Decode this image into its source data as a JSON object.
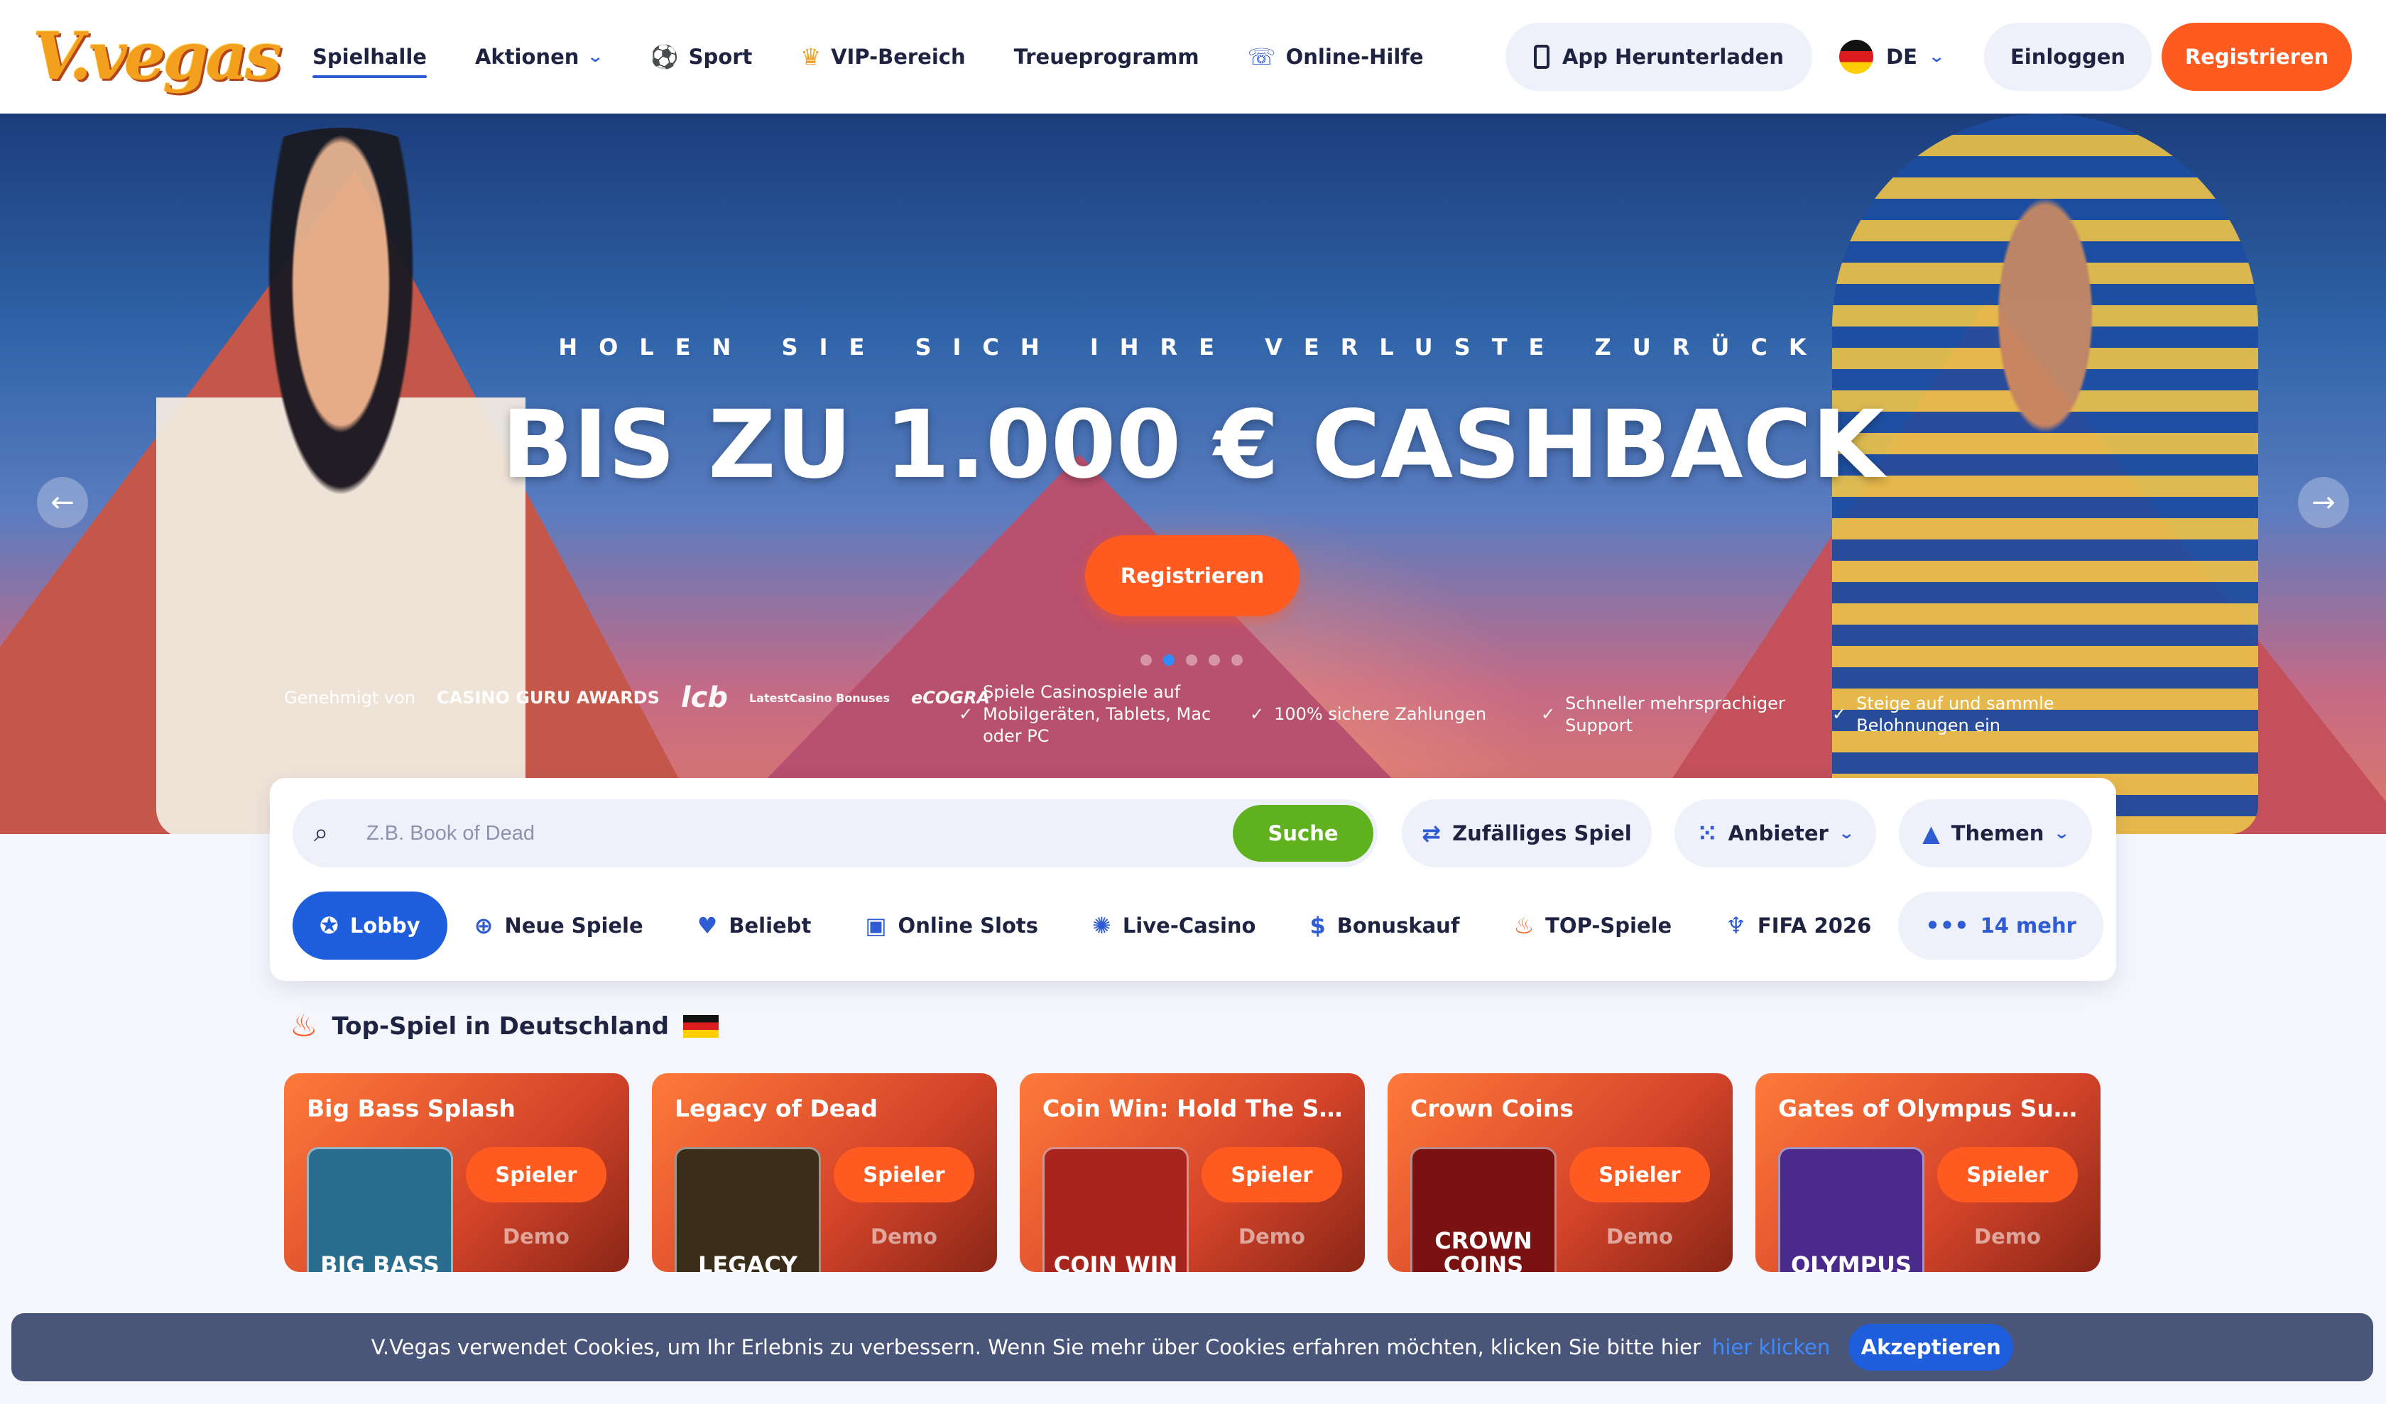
{
  "header": {
    "logo": "V.vegas",
    "nav": [
      {
        "label": "Spielhalle",
        "icon": "",
        "active": true
      },
      {
        "label": "Aktionen",
        "icon": "",
        "dropdown": true
      },
      {
        "label": "Sport",
        "icon": "soccer-ball-icon"
      },
      {
        "label": "VIP-Bereich",
        "icon": "crown-icon"
      },
      {
        "label": "Treueprogramm",
        "icon": ""
      },
      {
        "label": "Online-Hilfe",
        "icon": "headset-icon"
      }
    ],
    "app_button": "App Herunterladen",
    "language": "DE",
    "login": "Einloggen",
    "register": "Registrieren"
  },
  "hero": {
    "subtitle": "HOLEN SIE SICH IHRE VERLUSTE ZURÜCK",
    "title": "BIS ZU 1.000 € CASHBACK",
    "cta": "Registrieren",
    "slides": 5,
    "active_slide": 2,
    "trust_label": "Genehmigt von",
    "trust_logos": [
      "CASINO GURU AWARDS",
      "lcb",
      "LatestCasino Bonuses",
      "eCOGRA"
    ],
    "features": [
      "Spiele Casinospiele auf Mobilgeräten, Tablets, Mac oder PC",
      "100% sichere Zahlungen",
      "Schneller mehrsprachiger Support",
      "Steige auf und sammle Belohnungen ein"
    ]
  },
  "search": {
    "placeholder": "Z.B. Book of Dead",
    "button": "Suche",
    "random": "Zufälliges Spiel",
    "providers": "Anbieter",
    "themes": "Themen"
  },
  "categories": [
    {
      "label": "Lobby",
      "icon": "medal-icon",
      "active": true
    },
    {
      "label": "Neue Spiele",
      "icon": "plus-circle-icon"
    },
    {
      "label": "Beliebt",
      "icon": "heart-icon"
    },
    {
      "label": "Online Slots",
      "icon": "slot-machine-icon"
    },
    {
      "label": "Live-Casino",
      "icon": "chip-icon"
    },
    {
      "label": "Bonuskauf",
      "icon": "dollar-icon"
    },
    {
      "label": "TOP-Spiele",
      "icon": "flame-icon"
    },
    {
      "label": "FIFA 2026",
      "icon": "trophy-icon"
    },
    {
      "label": "14 mehr",
      "icon": "more-icon",
      "more": true
    }
  ],
  "top_games": {
    "title": "Top-Spiel in Deutschland",
    "play_label": "Spieler",
    "demo_label": "Demo",
    "games": [
      {
        "title": "Big Bass Splash",
        "thumb": "BIG BASS",
        "color": "#2a6e8f"
      },
      {
        "title": "Legacy of Dead",
        "thumb": "LEGACY",
        "color": "#3a2d1a"
      },
      {
        "title": "Coin Win: Hold The Spin",
        "thumb": "COIN WIN",
        "color": "#a8251d"
      },
      {
        "title": "Crown Coins",
        "thumb": "CROWN COINS",
        "color": "#7a1212"
      },
      {
        "title": "Gates of Olympus Super ...",
        "thumb": "OLYMPUS",
        "color": "#4a2a8a"
      }
    ]
  },
  "cookie": {
    "text": "V.Vegas verwendet Cookies, um Ihr Erlebnis zu verbessern. Wenn Sie mehr über Cookies erfahren möchten, klicken Sie bitte hier",
    "link": "hier klicken",
    "accept": "Akzeptieren"
  },
  "colors": {
    "accent": "#ff5a1f",
    "primary": "#1e5ddb",
    "search_button": "#5fb21d"
  }
}
